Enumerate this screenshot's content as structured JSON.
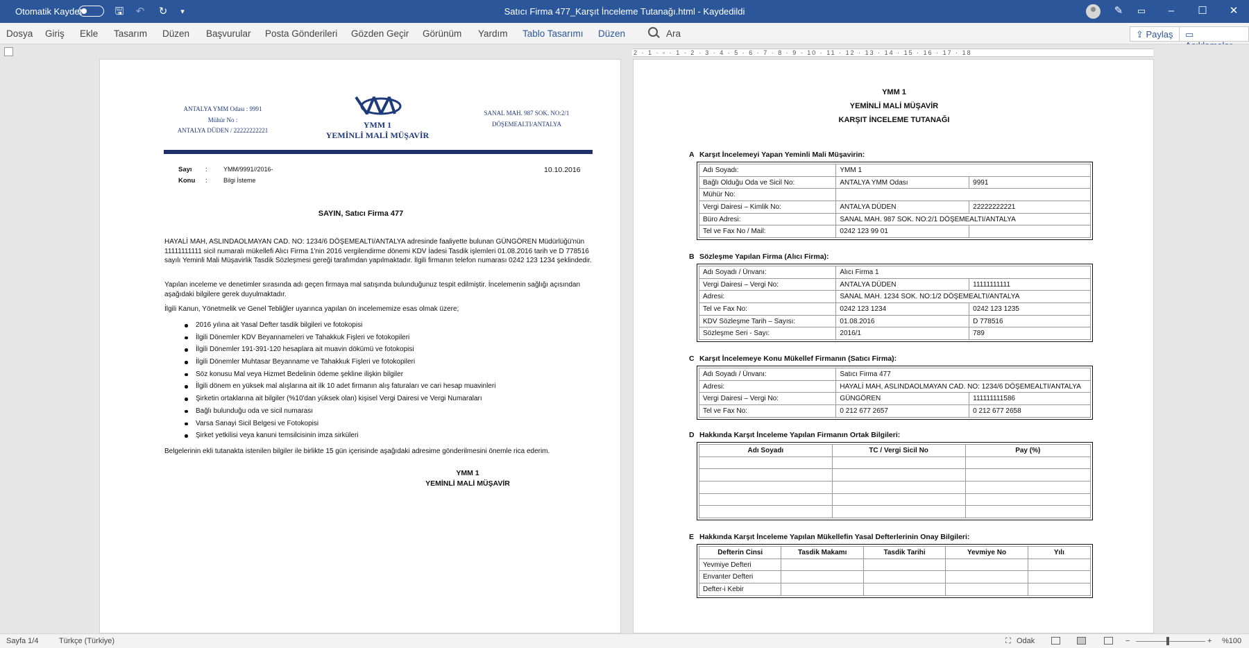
{
  "titlebar": {
    "autosave_label": "Otomatik Kaydet",
    "doc_title": "Satıcı Firma 477_Karşıt İnceleme Tutanağı.html  -  Kaydedildi"
  },
  "ribbon": {
    "tabs": [
      "Dosya",
      "Giriş",
      "Ekle",
      "Tasarım",
      "Düzen",
      "Başvurular",
      "Posta Gönderileri",
      "Gözden Geçir",
      "Görünüm",
      "Yardım",
      "Tablo Tasarımı",
      "Düzen"
    ],
    "search": "Ara",
    "share": "Paylaş",
    "comments": "Açıklamalar"
  },
  "ruler": "2 · 1 · ▫ · 1 · 2 · 3 · 4 · 5 · 6 · 7 · 8 · 9 · 10 · 11 · 12 · 13 · 14 · 15 · 16 · 17 · 18",
  "page1": {
    "left_header": [
      "ANTALYA YMM Odası : 9991",
      "Mühür No :",
      "ANTALYA DÜDEN / 22222222221"
    ],
    "center_header": [
      "YMM 1",
      "YEMİNLİ MALİ MÜŞAVİR"
    ],
    "right_header": [
      "SANAL MAH. 987 SOK. NO:2/1",
      "DÖŞEMEALTI/ANTALYA"
    ],
    "sayi_label": "Sayı",
    "sayi_value": "YMM/9991//2016-",
    "konu_label": "Konu",
    "konu_value": "Bilgi İsteme",
    "colon": ":",
    "date": "10.10.2016",
    "salutation": "SAYIN, Satıcı Firma 477",
    "para1": "HAYALİ MAH, ASLINDAOLMAYAN CAD. NO: 1234/6 DÖŞEMEALTI/ANTALYA adresinde faaliyette bulunan GÜNGÖREN Müdürlüğü'nün 11111111111 sicil numaralı mükellefi Alıcı Firma 1'nin 2016 vergilendirme dönemi KDV İadesi Tasdik işlemleri 01.08.2016 tarih ve D 778516 sayılı Yeminli Mali Müşavirlik Tasdik Sözleşmesi gereği tarafımdan yapılmaktadır. İlgili firmanın telefon numarası 0242 123 1234 şeklindedir.",
    "para2": "Yapılan inceleme ve denetimler sırasında adı geçen firmaya mal satışında bulunduğunuz tespit edilmiştir. İncelemenin sağlığı açısından aşağıdaki bilgilere gerek duyulmaktadır.",
    "para3": "İlgili Kanun, Yönetmelik ve Genel Tebliğler uyarınca yapılan ön incelememize esas olmak üzere;",
    "bullets": [
      "2016 yılına ait Yasal Defter tasdik bilgileri ve fotokopisi",
      "İlgili Dönemler KDV Beyannameleri ve Tahakkuk Fişleri ve fotokopileri",
      "İlgili Dönemler 191-391-120 hesaplara ait muavin dökümü ve fotokopisi",
      "İlgili Dönemler Muhtasar Beyanname ve Tahakkuk Fişleri ve fotokopileri",
      "Söz konusu Mal veya Hizmet Bedelinin ödeme şekline ilişkin bilgiler",
      "İlgili dönem en yüksek mal alışlarına ait ilk 10 adet firmanın alış faturaları ve cari hesap muavinleri",
      "Şirketin ortaklarına ait bilgiler (%10'dan yüksek olan) kişisel Vergi Dairesi ve Vergi Numaraları",
      "Bağlı bulunduğu oda ve sicil numarası",
      "Varsa Sanayi Sicil Belgesi ve Fotokopisi",
      "Şirket yetkilisi veya kanuni temsilcisinin imza sirküleri"
    ],
    "para4": "Belgelerinin ekli tutanakta istenilen bilgiler ile birlikte 15 gün içerisinde aşağıdaki adresime gönderilmesini önemle rica ederim.",
    "sign1": "YMM 1",
    "sign2": "YEMİNLİ MALİ MÜŞAVİR"
  },
  "page2": {
    "h1": "YMM 1",
    "h2": "YEMİNLİ MALİ MÜŞAVİR",
    "h3": "KARŞIT İNCELEME TUTANAĞI",
    "secA": {
      "letter": "A",
      "title": "Karşıt İncelemeyi Yapan Yeminli Mali Müşavirin:",
      "rows": [
        [
          "Adı Soyadı:",
          "YMM 1",
          ""
        ],
        [
          "Bağlı Olduğu Oda ve Sicil No:",
          "ANTALYA YMM Odası",
          "9991"
        ],
        [
          "Mühür No:",
          "",
          ""
        ],
        [
          "Vergi Dairesi – Kimlik No:",
          "ANTALYA DÜDEN",
          "22222222221"
        ],
        [
          "Büro Adresi:",
          "SANAL MAH. 987 SOK. NO:2/1 DÖŞEMEALTI/ANTALYA",
          ""
        ],
        [
          "Tel ve Fax No / Mail:",
          "0242 123 99 01",
          ""
        ]
      ]
    },
    "secB": {
      "letter": "B",
      "title": "Sözleşme Yapılan Firma (Alıcı Firma):",
      "rows": [
        [
          "Adı Soyadı / Ünvanı:",
          "Alıcı Firma 1",
          ""
        ],
        [
          "Vergi Dairesi – Vergi No:",
          "ANTALYA DÜDEN",
          "11111111111"
        ],
        [
          "Adresi:",
          "SANAL MAH. 1234 SOK. NO:1/2 DÖŞEMEALTI/ANTALYA",
          ""
        ],
        [
          "Tel ve Fax No:",
          "0242 123 1234",
          "0242 123 1235"
        ],
        [
          "KDV Sözleşme Tarih – Sayısı:",
          "01.08.2016",
          "D 778516"
        ],
        [
          "Sözleşme Seri - Sayı:",
          "2016/1",
          "789"
        ]
      ]
    },
    "secC": {
      "letter": "C",
      "title": "Karşıt İncelemeye Konu Mükellef Firmanın (Satıcı Firma):",
      "rows": [
        [
          "Adı Soyadı / Ünvanı:",
          "Satıcı Firma 477",
          ""
        ],
        [
          "Adresi:",
          "HAYALİ MAH, ASLINDAOLMAYAN CAD. NO: 1234/6 DÖŞEMEALTI/ANTALYA",
          ""
        ],
        [
          "Vergi Dairesi – Vergi No:",
          "GÜNGÖREN",
          "111111111586"
        ],
        [
          "Tel ve Fax No:",
          "0 212 677 2657",
          "0 212 677 2658"
        ]
      ]
    },
    "secD": {
      "letter": "D",
      "title": "Hakkında Karşıt İnceleme Yapılan Firmanın Ortak Bilgileri:",
      "headers": [
        "Adı Soyadı",
        "TC / Vergi Sicil No",
        "Pay (%)"
      ]
    },
    "secE": {
      "letter": "E",
      "title": "Hakkında Karşıt İnceleme Yapılan Mükellefin Yasal Defterlerinin Onay Bilgileri:",
      "headers": [
        "Defterin Cinsi",
        "Tasdik Makamı",
        "Tasdik Tarihi",
        "Yevmiye No",
        "Yılı"
      ],
      "rows": [
        "Yevmiye Defteri",
        "Envanter Defteri",
        "Defter-i Kebir"
      ]
    }
  },
  "statusbar": {
    "page": "Sayfa 1/4",
    "language": "Türkçe (Türkiye)",
    "focus": "Odak",
    "zoom": "%100"
  }
}
